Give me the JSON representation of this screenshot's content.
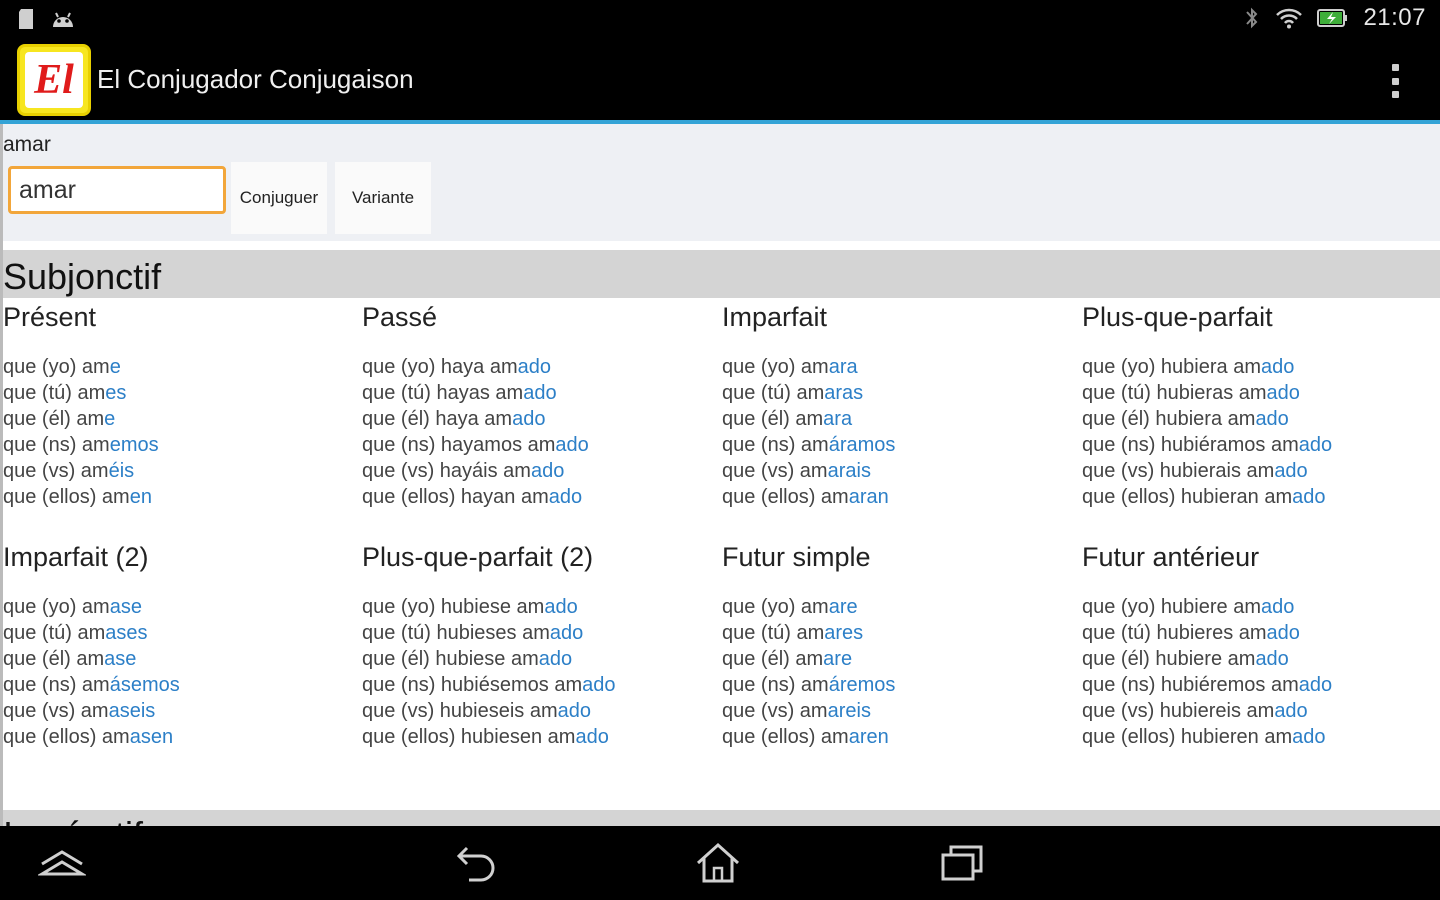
{
  "status_bar": {
    "time": "21:07",
    "left_icons": [
      "sd-card-icon",
      "android-icon"
    ],
    "right_icons": [
      "bluetooth-icon",
      "wifi-icon",
      "battery-charging-icon"
    ]
  },
  "action_bar": {
    "logo_text": "El",
    "title": "El Conjugador Conjugaison",
    "overflow_icon": "overflow-menu-icon"
  },
  "search": {
    "label": "amar",
    "input_value": "amar",
    "conjugate_label": "Conjuguer",
    "variant_label": "Variante"
  },
  "section": {
    "title": "Subjonctif",
    "next_title": "Impératif"
  },
  "tenses": [
    {
      "title": "Présent",
      "rows": [
        {
          "stem": "que (yo) am",
          "ending": "e"
        },
        {
          "stem": "que (tú) am",
          "ending": "es"
        },
        {
          "stem": "que (él) am",
          "ending": "e"
        },
        {
          "stem": "que (ns) am",
          "ending": "emos"
        },
        {
          "stem": "que (vs) am",
          "ending": "éis"
        },
        {
          "stem": "que (ellos) am",
          "ending": "en"
        }
      ]
    },
    {
      "title": "Passé",
      "rows": [
        {
          "stem": "que (yo) haya am",
          "ending": "ado"
        },
        {
          "stem": "que (tú) hayas am",
          "ending": "ado"
        },
        {
          "stem": "que (él) haya am",
          "ending": "ado"
        },
        {
          "stem": "que (ns) hayamos am",
          "ending": "ado"
        },
        {
          "stem": "que (vs) hayáis am",
          "ending": "ado"
        },
        {
          "stem": "que (ellos) hayan am",
          "ending": "ado"
        }
      ]
    },
    {
      "title": "Imparfait",
      "rows": [
        {
          "stem": "que (yo) am",
          "ending": "ara"
        },
        {
          "stem": "que (tú) am",
          "ending": "aras"
        },
        {
          "stem": "que (él) am",
          "ending": "ara"
        },
        {
          "stem": "que (ns) am",
          "ending": "áramos"
        },
        {
          "stem": "que (vs) am",
          "ending": "arais"
        },
        {
          "stem": "que (ellos) am",
          "ending": "aran"
        }
      ]
    },
    {
      "title": "Plus-que-parfait",
      "rows": [
        {
          "stem": "que (yo) hubiera am",
          "ending": "ado"
        },
        {
          "stem": "que (tú) hubieras am",
          "ending": "ado"
        },
        {
          "stem": "que (él) hubiera am",
          "ending": "ado"
        },
        {
          "stem": "que (ns) hubiéramos am",
          "ending": "ado"
        },
        {
          "stem": "que (vs) hubierais am",
          "ending": "ado"
        },
        {
          "stem": "que (ellos) hubieran am",
          "ending": "ado"
        }
      ]
    },
    {
      "title": "Imparfait (2)",
      "rows": [
        {
          "stem": "que (yo) am",
          "ending": "ase"
        },
        {
          "stem": "que (tú) am",
          "ending": "ases"
        },
        {
          "stem": "que (él) am",
          "ending": "ase"
        },
        {
          "stem": "que (ns) am",
          "ending": "ásemos"
        },
        {
          "stem": "que (vs) am",
          "ending": "aseis"
        },
        {
          "stem": "que (ellos) am",
          "ending": "asen"
        }
      ]
    },
    {
      "title": "Plus-que-parfait (2)",
      "rows": [
        {
          "stem": "que (yo) hubiese am",
          "ending": "ado"
        },
        {
          "stem": "que (tú) hubieses am",
          "ending": "ado"
        },
        {
          "stem": "que (él) hubiese am",
          "ending": "ado"
        },
        {
          "stem": "que (ns) hubiésemos am",
          "ending": "ado"
        },
        {
          "stem": "que (vs) hubieseis am",
          "ending": "ado"
        },
        {
          "stem": "que (ellos) hubiesen am",
          "ending": "ado"
        }
      ]
    },
    {
      "title": "Futur simple",
      "rows": [
        {
          "stem": "que (yo) am",
          "ending": "are"
        },
        {
          "stem": "que (tú) am",
          "ending": "ares"
        },
        {
          "stem": "que (él) am",
          "ending": "are"
        },
        {
          "stem": "que (ns) am",
          "ending": "áremos"
        },
        {
          "stem": "que (vs) am",
          "ending": "areis"
        },
        {
          "stem": "que (ellos) am",
          "ending": "aren"
        }
      ]
    },
    {
      "title": "Futur antérieur",
      "rows": [
        {
          "stem": "que (yo) hubiere am",
          "ending": "ado"
        },
        {
          "stem": "que (tú) hubieres am",
          "ending": "ado"
        },
        {
          "stem": "que (él) hubiere am",
          "ending": "ado"
        },
        {
          "stem": "que (ns) hubiéremos am",
          "ending": "ado"
        },
        {
          "stem": "que (vs) hubiereis am",
          "ending": "ado"
        },
        {
          "stem": "que (ellos) hubieren am",
          "ending": "ado"
        }
      ]
    }
  ],
  "nav_bar": {
    "icons": [
      "hide-bar-icon",
      "back-icon",
      "home-icon",
      "recent-apps-icon"
    ]
  },
  "colors": {
    "accent_line": "#33a3d6",
    "ending_blue": "#2c7fc7",
    "input_border": "#f2a63a",
    "section_bg": "#d4d4d4"
  }
}
